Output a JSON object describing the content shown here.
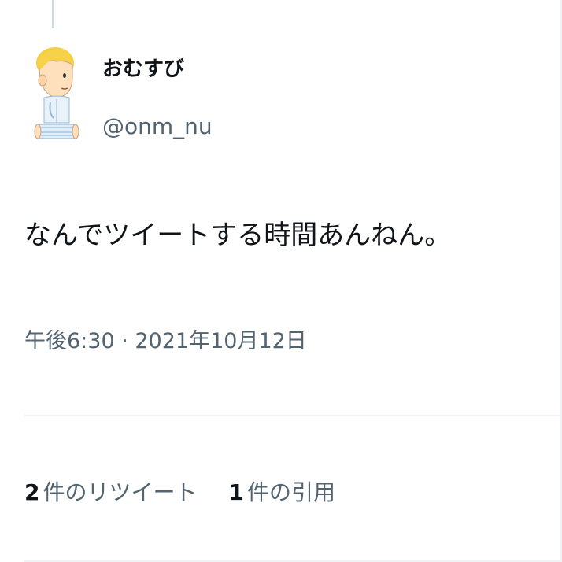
{
  "tweet": {
    "author": {
      "display_name": "おむすび",
      "username": "@onm_nu"
    },
    "text": "なんでツイートする時間あんねん。",
    "timestamp": "午後6:30 · 2021年10月12日",
    "stats": {
      "retweets": {
        "count": "2",
        "label": "件のリツイート"
      },
      "quotes": {
        "count": "1",
        "label": "件の引用"
      }
    }
  },
  "colors": {
    "text_primary": "#0f1419",
    "text_secondary": "#536471",
    "divider": "#eff3f4",
    "thread_line": "#cfd9de"
  }
}
